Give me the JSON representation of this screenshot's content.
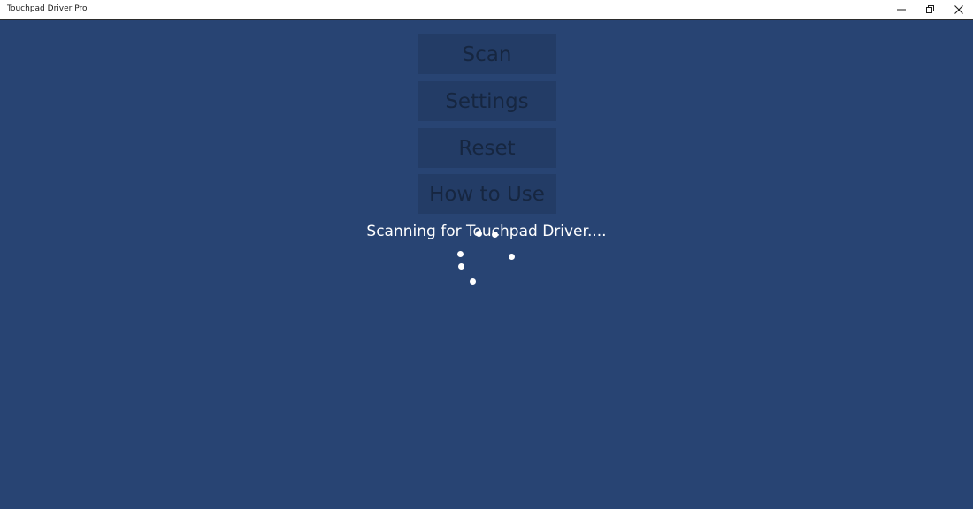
{
  "window": {
    "title": "Touchpad Driver Pro",
    "controls": {
      "minimize": "minimize-icon",
      "maximize": "restore-icon",
      "close": "close-icon"
    }
  },
  "menu": {
    "scan_label": "Scan",
    "settings_label": "Settings",
    "reset_label": "Reset",
    "howto_label": "How to Use"
  },
  "status": {
    "message": "Scanning for Touchpad Driver...."
  },
  "colors": {
    "background": "#284473",
    "button_bg": "#233c66",
    "button_text": "#162640",
    "status_text": "#ffffff"
  }
}
